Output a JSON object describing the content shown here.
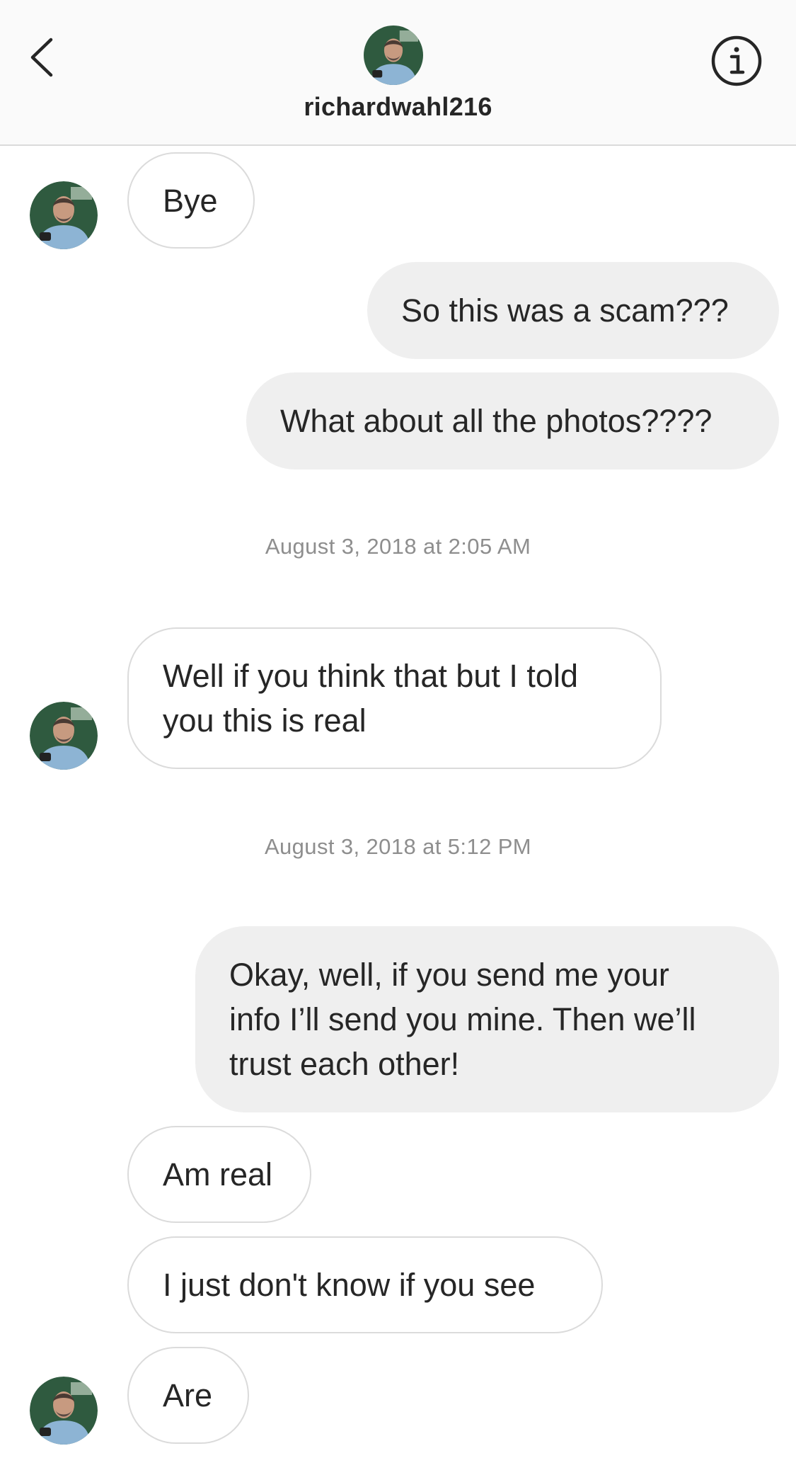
{
  "header": {
    "username": "richardwahl216",
    "back_icon": "chevron-left-icon",
    "info_icon": "info-circle-icon"
  },
  "messages": [
    {
      "text": "Bye",
      "direction": "incoming"
    },
    {
      "text": "So this was a scam???",
      "direction": "outgoing"
    },
    {
      "text": "What about all the photos????",
      "direction": "outgoing"
    },
    {
      "text": "Well if you think that but I told you this is real",
      "lines": [
        "Well if you think that but I told",
        "you this is real"
      ],
      "direction": "incoming"
    },
    {
      "text": "Okay, well, if you send me your info I’ll send you mine. Then we’ll trust each other!",
      "lines": [
        "Okay, well, if you send me your",
        "info I’ll send you mine. Then we’ll",
        "trust each other!"
      ],
      "direction": "outgoing"
    },
    {
      "text": "Am real",
      "direction": "incoming"
    },
    {
      "text": "I just don't know if you see",
      "direction": "incoming"
    },
    {
      "text": "Are",
      "direction": "incoming"
    }
  ],
  "timestamps": [
    "August 3, 2018 at 2:05 AM",
    "August 3, 2018 at 5:12 PM"
  ],
  "colors": {
    "header_bg": "#fafafa",
    "outgoing_bubble": "#efefef",
    "incoming_border": "#dbdbdb",
    "timestamp": "#8e8e8e",
    "text": "#262626"
  }
}
